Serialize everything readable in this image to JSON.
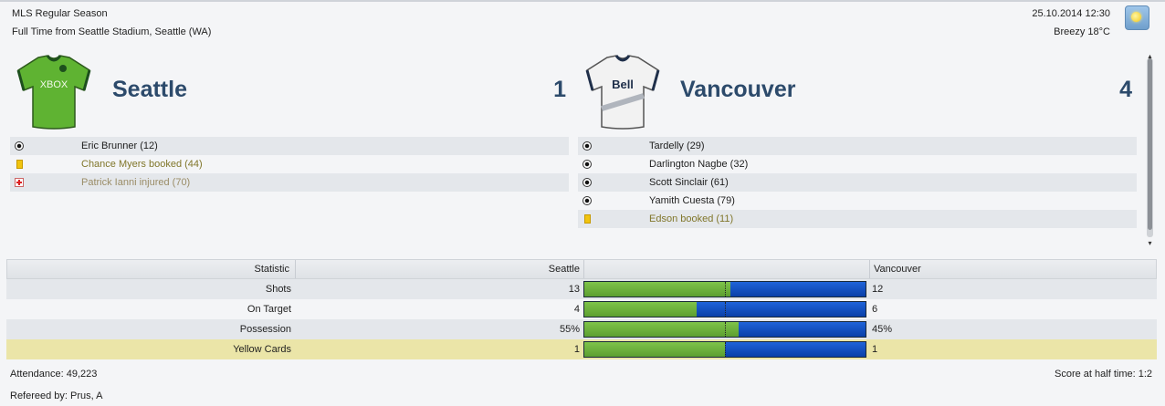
{
  "match": {
    "competition": "MLS Regular Season",
    "status_line": "Full Time from Seattle Stadium, Seattle (WA)",
    "datetime": "25.10.2014 12:30",
    "weather": "Breezy 18°C",
    "weather_icon": "sun-icon"
  },
  "home": {
    "name": "Seattle",
    "score": "1",
    "shirt_colors": {
      "body": "#5fb332",
      "trim": "#1d4f1d"
    },
    "shirt_text": "XBOX",
    "events": [
      {
        "type": "goal",
        "text": "Eric Brunner (12)"
      },
      {
        "type": "booking",
        "text": "Chance Myers booked (44)"
      },
      {
        "type": "injury",
        "text": "Patrick Ianni injured (70)"
      }
    ]
  },
  "away": {
    "name": "Vancouver",
    "score": "4",
    "shirt_colors": {
      "body": "#f2f2f2",
      "trim": "#1f2f4a"
    },
    "shirt_text": "Bell",
    "events": [
      {
        "type": "goal",
        "text": "Tardelly (29)"
      },
      {
        "type": "goal",
        "text": "Darlington Nagbe (32)"
      },
      {
        "type": "goal",
        "text": "Scott Sinclair (61)"
      },
      {
        "type": "goal",
        "text": "Yamith Cuesta (79)"
      },
      {
        "type": "booking",
        "text": "Edson booked (11)"
      }
    ]
  },
  "stats": {
    "header": {
      "statistic": "Statistic",
      "home": "Seattle",
      "away": "Vancouver"
    },
    "colors": {
      "home": "#6db53e",
      "away": "#0b4ec6",
      "highlight": "#ebe5a8"
    },
    "rows": [
      {
        "label": "Shots",
        "home": "13",
        "away": "12",
        "home_share": 0.52
      },
      {
        "label": "On Target",
        "home": "4",
        "away": "6",
        "home_share": 0.4
      },
      {
        "label": "Possession",
        "home": "55%",
        "away": "45%",
        "home_share": 0.55
      },
      {
        "label": "Yellow Cards",
        "home": "1",
        "away": "1",
        "home_share": 0.5,
        "highlighted": true
      }
    ]
  },
  "footer": {
    "attendance": "Attendance: 49,223",
    "referee": "Refereed by: Prus, A",
    "half_time": "Score at half time: 1:2"
  }
}
